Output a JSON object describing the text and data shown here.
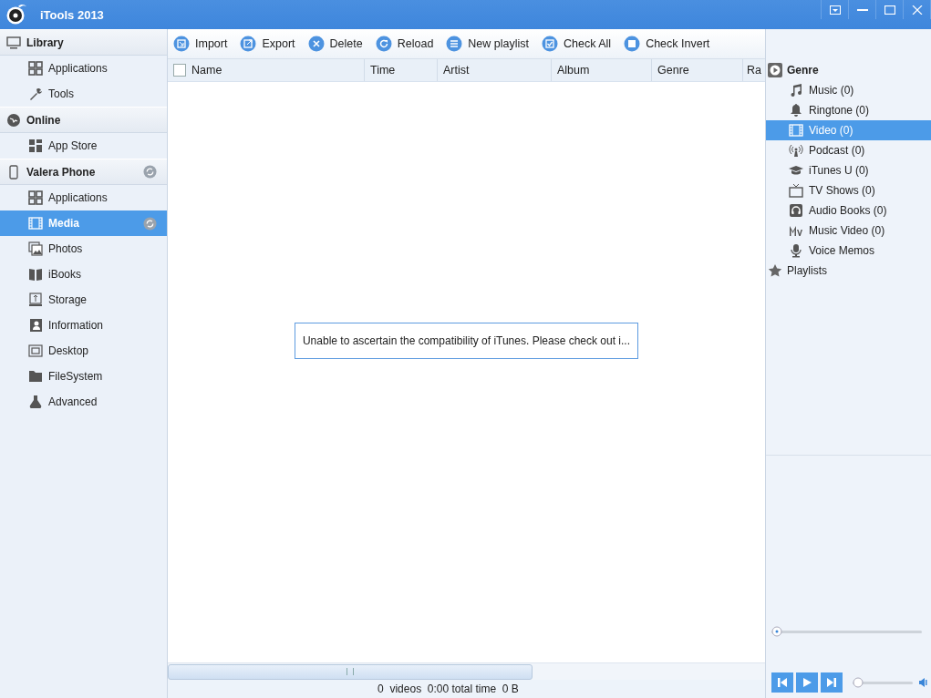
{
  "window": {
    "title": "iTools 2013"
  },
  "sidebar": {
    "sections": [
      {
        "title": "Library",
        "sync": false,
        "items": [
          {
            "label": "Applications",
            "selected": false,
            "sync": false
          },
          {
            "label": "Tools",
            "selected": false,
            "sync": false
          }
        ]
      },
      {
        "title": "Online",
        "sync": false,
        "items": [
          {
            "label": "App Store",
            "selected": false,
            "sync": false
          }
        ]
      },
      {
        "title": "Valera Phone",
        "sync": true,
        "items": [
          {
            "label": "Applications",
            "selected": false,
            "sync": false
          },
          {
            "label": "Media",
            "selected": true,
            "sync": true
          },
          {
            "label": "Photos",
            "selected": false,
            "sync": false
          },
          {
            "label": "iBooks",
            "selected": false,
            "sync": false
          },
          {
            "label": "Storage",
            "selected": false,
            "sync": false
          },
          {
            "label": "Information",
            "selected": false,
            "sync": false
          },
          {
            "label": "Desktop",
            "selected": false,
            "sync": false
          },
          {
            "label": "FileSystem",
            "selected": false,
            "sync": false
          },
          {
            "label": "Advanced",
            "selected": false,
            "sync": false
          }
        ]
      }
    ]
  },
  "toolbar": [
    "Import",
    "Export",
    "Delete",
    "Reload",
    "New playlist",
    "Check All",
    "Check Invert"
  ],
  "table": {
    "select_all_checked": false,
    "columns": [
      "Name",
      "Time",
      "Artist",
      "Album",
      "Genre",
      "Ra"
    ]
  },
  "message": "Unable to ascertain the compatibility of iTunes. Please check out i...",
  "status_bar": "0  videos  0:00 total time  0 B",
  "genre_panel": {
    "title": "Genre",
    "items": [
      {
        "label": "Music (0)",
        "selected": false
      },
      {
        "label": "Ringtone (0)",
        "selected": false
      },
      {
        "label": "Video (0)",
        "selected": true
      },
      {
        "label": "Podcast (0)",
        "selected": false
      },
      {
        "label": "iTunes U (0)",
        "selected": false
      },
      {
        "label": "TV Shows (0)",
        "selected": false
      },
      {
        "label": "Audio Books (0)",
        "selected": false
      },
      {
        "label": "Music Video (0)",
        "selected": false
      },
      {
        "label": "Voice Memos",
        "selected": false
      }
    ],
    "playlists": "Playlists"
  },
  "player": {
    "progress": {
      "level": 0
    },
    "volume": {
      "level": 0
    }
  }
}
